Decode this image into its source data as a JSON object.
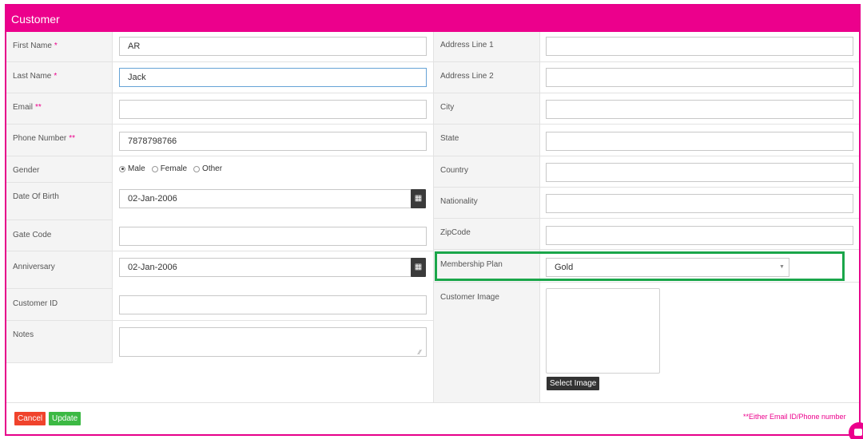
{
  "header": {
    "title": "Customer"
  },
  "left": {
    "first_name": {
      "label": "First Name",
      "required": "*",
      "value": "AR"
    },
    "last_name": {
      "label": "Last Name",
      "required": "*",
      "value": "Jack"
    },
    "email": {
      "label": "Email",
      "required": "**",
      "value": ""
    },
    "phone": {
      "label": "Phone Number",
      "required": "**",
      "value": "7878798766"
    },
    "gender": {
      "label": "Gender",
      "options": [
        "Male",
        "Female",
        "Other"
      ],
      "selected": "Male"
    },
    "dob": {
      "label": "Date Of Birth",
      "value": "02-Jan-2006"
    },
    "gate_code": {
      "label": "Gate Code",
      "value": ""
    },
    "anniversary": {
      "label": "Anniversary",
      "value": "02-Jan-2006"
    },
    "customer_id": {
      "label": "Customer ID",
      "value": ""
    },
    "notes": {
      "label": "Notes",
      "value": ""
    }
  },
  "right": {
    "address1": {
      "label": "Address Line 1",
      "value": ""
    },
    "address2": {
      "label": "Address Line 2",
      "value": ""
    },
    "city": {
      "label": "City",
      "value": ""
    },
    "state": {
      "label": "State",
      "value": ""
    },
    "country": {
      "label": "Country",
      "value": ""
    },
    "nationality": {
      "label": "Nationality",
      "value": ""
    },
    "zipcode": {
      "label": "ZipCode",
      "value": ""
    },
    "membership": {
      "label": "Membership Plan",
      "value": "Gold"
    },
    "customer_image": {
      "label": "Customer Image",
      "button": "Select Image"
    }
  },
  "footer": {
    "cancel": "Cancel",
    "update": "Update",
    "note": "**Either Email ID/Phone number"
  },
  "colors": {
    "accent": "#ec008c",
    "highlight": "#1aa64a",
    "cancel": "#f0432c",
    "update": "#3cb944"
  },
  "icons": {
    "calendar": "calendar-icon",
    "dropdown": "chevron-down-icon",
    "chat": "chat-icon"
  }
}
